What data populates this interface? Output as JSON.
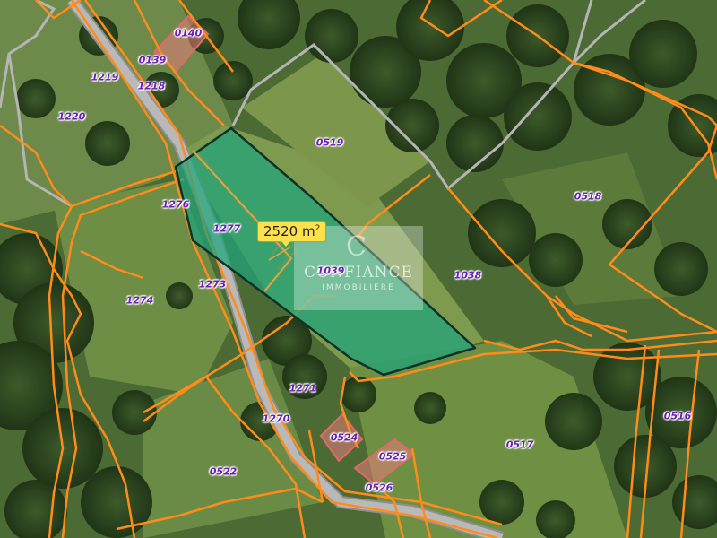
{
  "map": {
    "area_value": "2520",
    "area_unit": "m",
    "area_unit_exp": "2",
    "colors": {
      "parcel_border": "#ff8c1a",
      "selected_fill": "#1fa37a",
      "selected_border": "#0d3328",
      "building_fill": "#e87c7c",
      "road": "#b7b7b7",
      "label": "#6a1fb5"
    },
    "watermark": {
      "logo_text": "C",
      "title": "CONFIANCE",
      "subtitle": "IMMOBILIERE"
    },
    "parcels": [
      {
        "id": "0140"
      },
      {
        "id": "0139"
      },
      {
        "id": "1219"
      },
      {
        "id": "1218"
      },
      {
        "id": "1220"
      },
      {
        "id": "0519"
      },
      {
        "id": "0518"
      },
      {
        "id": "1276"
      },
      {
        "id": "1277"
      },
      {
        "id": "1039"
      },
      {
        "id": "1038"
      },
      {
        "id": "1274"
      },
      {
        "id": "1273"
      },
      {
        "id": "1271"
      },
      {
        "id": "1270"
      },
      {
        "id": "0524"
      },
      {
        "id": "0525"
      },
      {
        "id": "0526"
      },
      {
        "id": "0517"
      },
      {
        "id": "0516"
      },
      {
        "id": "0522"
      }
    ]
  }
}
